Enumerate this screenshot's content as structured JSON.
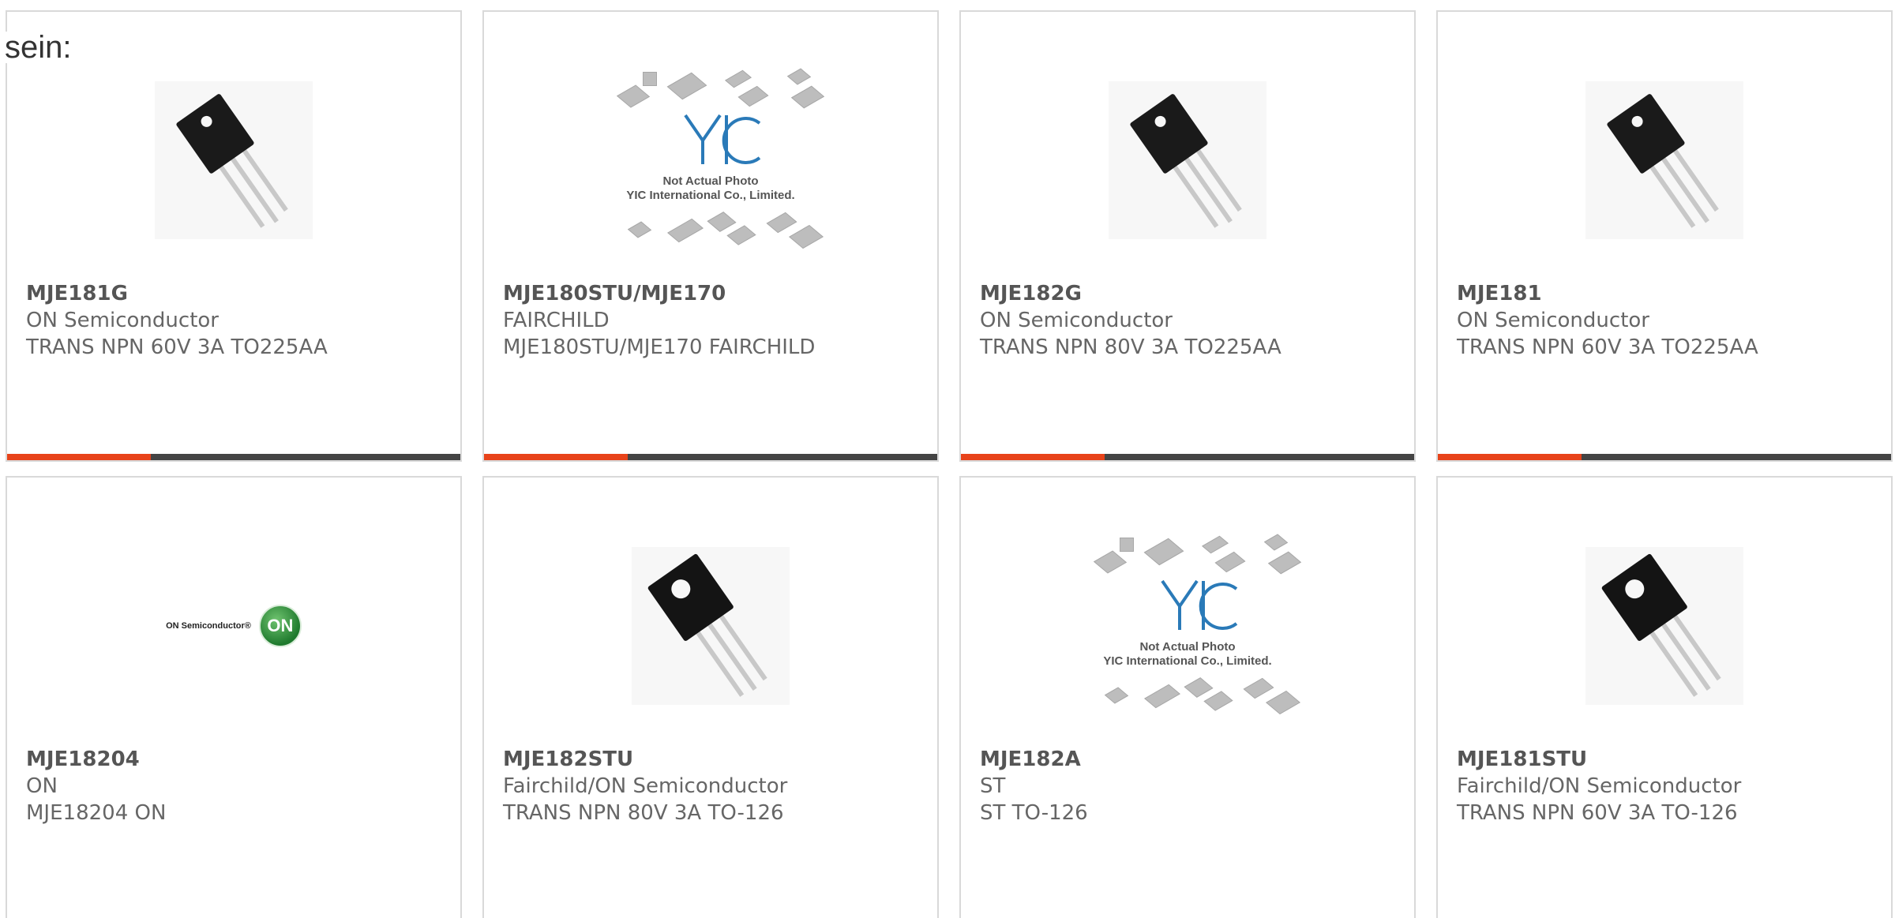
{
  "intro_text": "sein:",
  "accent_color": "#e8431a",
  "bar_color": "#444444",
  "products": [
    {
      "part": "MJE181G",
      "manufacturer": "ON Semiconductor",
      "description": "TRANS NPN 60V 3A TO225AA",
      "image": "transistor-to225-photo"
    },
    {
      "part": "MJE180STU/MJE170",
      "manufacturer": "FAIRCHILD",
      "description": "MJE180STU/MJE170 FAIRCHILD",
      "image": "yic-placeholder"
    },
    {
      "part": "MJE182G",
      "manufacturer": "ON Semiconductor",
      "description": "TRANS NPN 80V 3A TO225AA",
      "image": "transistor-to225-photo"
    },
    {
      "part": "MJE181",
      "manufacturer": "ON Semiconductor",
      "description": "TRANS NPN 60V 3A TO225AA",
      "image": "transistor-to225-photo"
    },
    {
      "part": "MJE18204",
      "manufacturer": "ON",
      "description": "MJE18204 ON",
      "image": "on-semiconductor-logo"
    },
    {
      "part": "MJE182STU",
      "manufacturer": "Fairchild/ON Semiconductor",
      "description": "TRANS NPN 80V 3A TO-126",
      "image": "transistor-to126-photo"
    },
    {
      "part": "MJE182A",
      "manufacturer": "ST",
      "description": "ST TO-126",
      "image": "yic-placeholder"
    },
    {
      "part": "MJE181STU",
      "manufacturer": "Fairchild/ON Semiconductor",
      "description": "TRANS NPN 60V 3A TO-126",
      "image": "transistor-to126-photo"
    }
  ],
  "yic_placeholder": {
    "line1": "Not Actual Photo",
    "line2": "YIC International Co., Limited."
  },
  "on_logo": {
    "wordmark": "ON Semiconductor®",
    "badge": "ON"
  }
}
